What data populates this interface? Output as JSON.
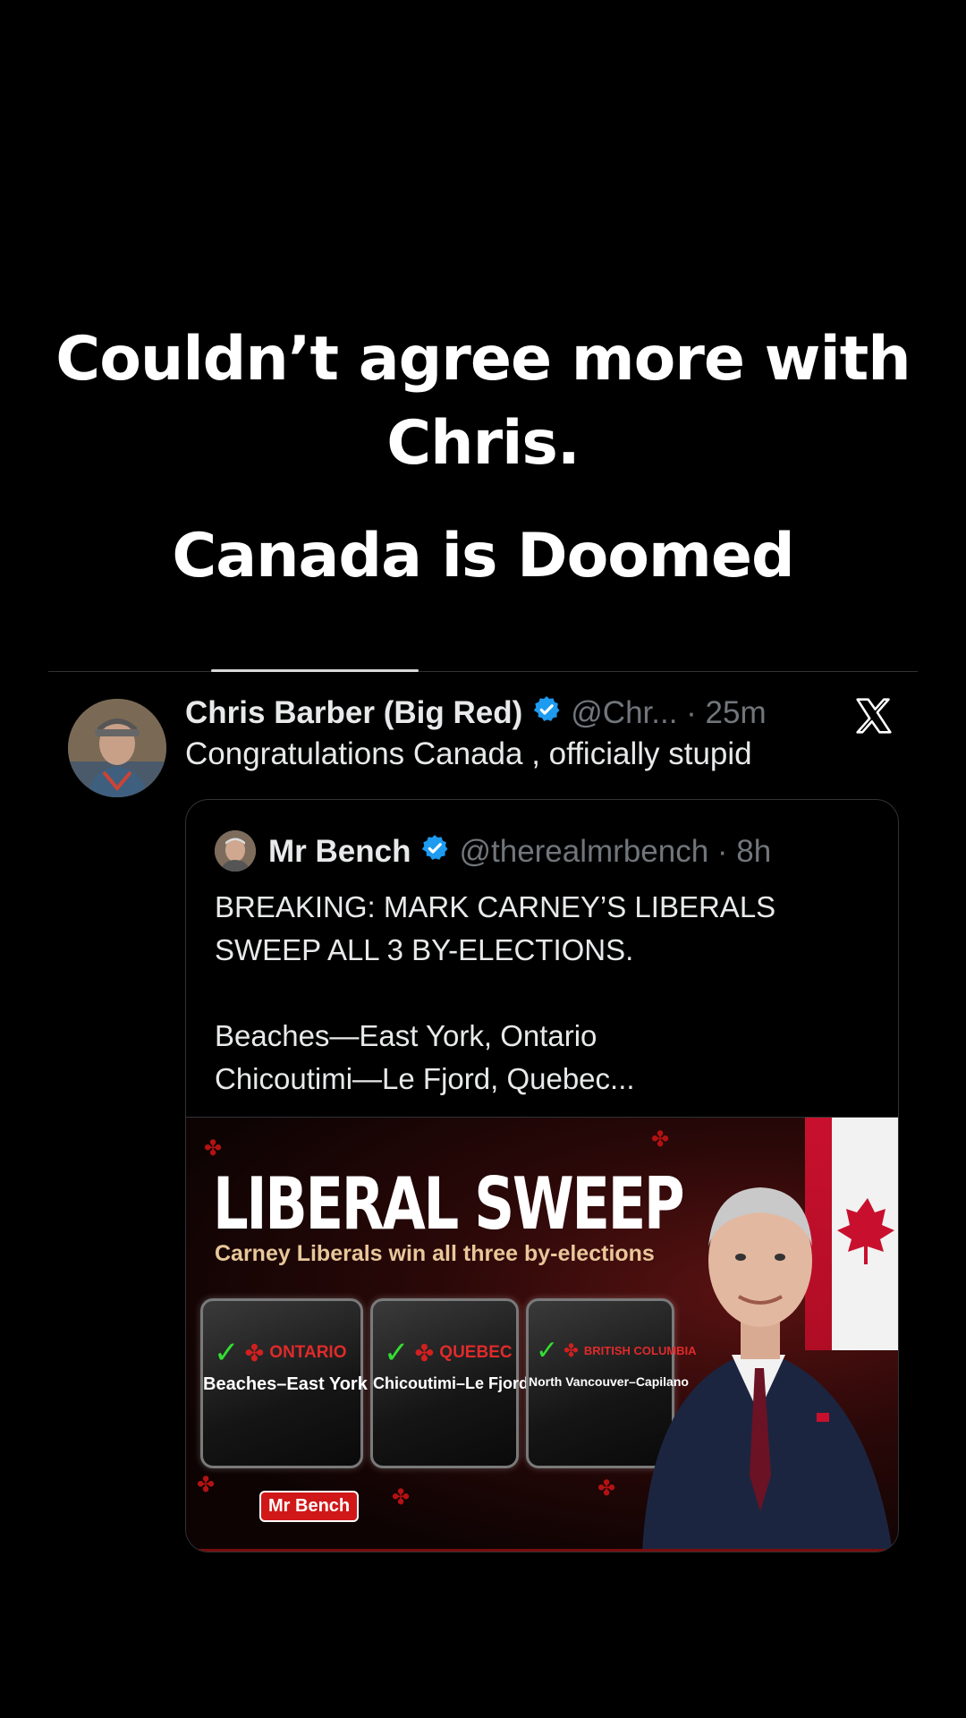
{
  "caption": {
    "line1": "Couldn’t agree more with",
    "line2": "Chris.",
    "line3": "Canada is Doomed"
  },
  "tweet": {
    "author_name": "Chris Barber (Big Red)",
    "handle_time": "@Chr... · 25m",
    "text": "Congratulations Canada , officially stupid",
    "verified_color": "#1d9bf0"
  },
  "quoted_tweet": {
    "author_name": "Mr Bench",
    "handle_time": "@therealmrbench · 8h",
    "body_lines": [
      "BREAKING: MARK CARNEY’S LIBERALS",
      "SWEEP ALL 3 BY-ELECTIONS.",
      "Beaches—East York, Ontario",
      "Chicoutimi—Le Fjord, Quebec..."
    ],
    "media": {
      "title": "LIBERAL SWEEP",
      "subtitle": "Carney Liberals win all three by-elections",
      "cards": [
        {
          "region": "ONTARIO",
          "riding": "Beaches–East York"
        },
        {
          "region": "QUEBEC",
          "riding": "Chicoutimi–Le Fjord"
        },
        {
          "region": "BRITISH COLUMBIA",
          "riding": "North Vancouver–Capilano"
        }
      ],
      "badge": "Mr Bench"
    }
  },
  "icons": {
    "platform_logo": "x-logo-icon",
    "verified": "verified-badge-icon",
    "check": "check-icon",
    "maple_leaf": "maple-leaf-icon"
  }
}
